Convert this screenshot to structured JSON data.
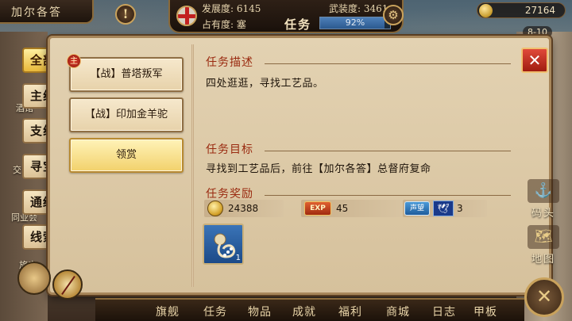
{
  "header": {
    "location": "加尔各答",
    "alert_glyph": "!",
    "development_label": "发展度:",
    "development_value": "6145",
    "armament_label": "武装度:",
    "armament_value": "3461",
    "occupation_label": "占有度:",
    "occupation_value": "塞",
    "window_title": "任务",
    "occupation_progress_text": "92%",
    "occupation_progress": 0.92,
    "coins": "27164",
    "date": "8-10"
  },
  "categories": [
    {
      "label": "全部",
      "active": true
    },
    {
      "label": "主线",
      "active": false
    },
    {
      "label": "支线",
      "active": false
    },
    {
      "label": "寻宝",
      "active": false
    },
    {
      "label": "通缉",
      "active": false
    },
    {
      "label": "线索",
      "active": false
    }
  ],
  "quests": [
    {
      "label": "【战】普塔叛军",
      "badge": "主",
      "active": false
    },
    {
      "label": "【战】印加金羊驼",
      "badge": "",
      "active": false
    },
    {
      "label": "领赏",
      "badge": "",
      "active": true
    }
  ],
  "details": {
    "description_header": "任务描述",
    "description_text": "四处逛逛，寻找工艺品。",
    "objective_header": "任务目标",
    "objective_text": "寻找到工艺品后，前往【加尔各答】总督府复命",
    "rewards_header": "任务奖励",
    "rewards": {
      "coins": "24388",
      "exp_icon": "EXP",
      "exp": "45",
      "fame_icon": "声望",
      "fame": "3"
    },
    "item_count": "1"
  },
  "close_glyph": "✕",
  "side_buttons": {
    "dock": "码头",
    "map": "地图"
  },
  "left_labels": {
    "tavern": "酒馆",
    "trade": "交",
    "guild": "同业会",
    "inn": "旅店"
  },
  "bottom_nav": [
    "旗舰",
    "任务",
    "物品",
    "成就",
    "福利",
    "商城",
    "日志",
    "甲板"
  ],
  "colors": {
    "accent_red": "#9a2a10",
    "panel_bg": "#e3d2b2",
    "active_gold": "#f2d16c"
  }
}
